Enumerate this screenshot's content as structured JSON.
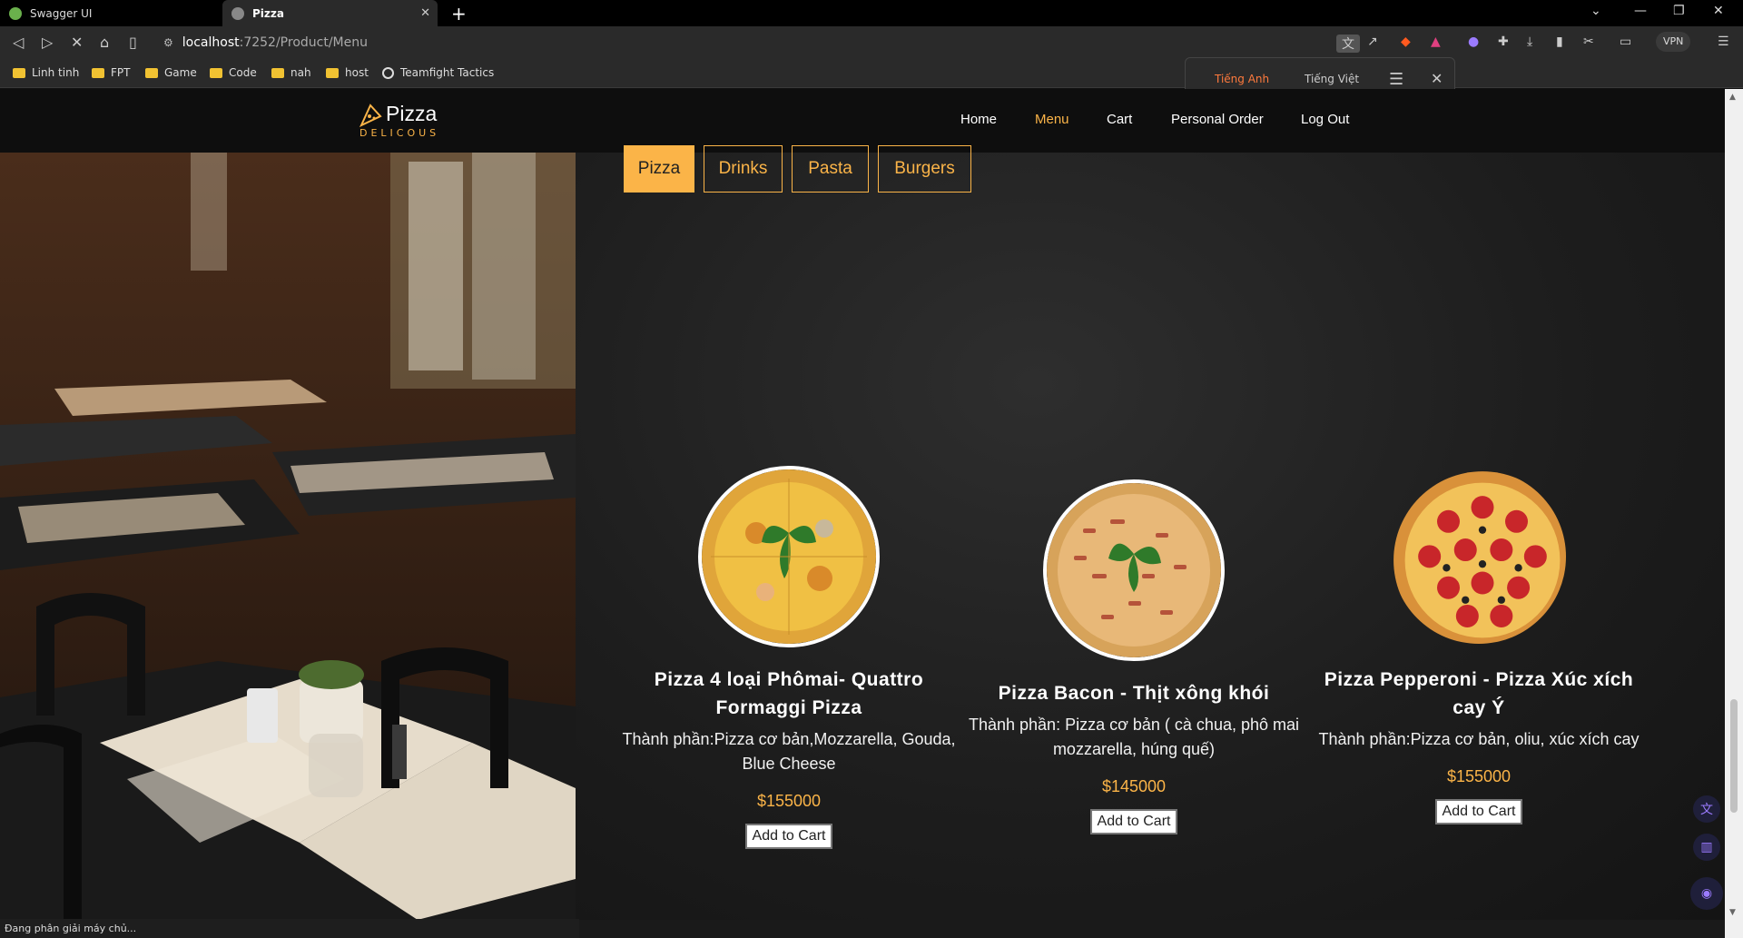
{
  "browser": {
    "tabs": [
      {
        "label": "Swagger UI"
      },
      {
        "label": "Pizza"
      }
    ],
    "url_host": "localhost",
    "url_path": ":7252/Product/Menu",
    "vpn_label": "VPN",
    "bookmarks": [
      "Linh tinh",
      "FPT",
      "Game",
      "Code",
      "nah",
      "host",
      "Teamfight Tactics"
    ],
    "status_text": "Đang phân giải máy chủ..."
  },
  "translate": {
    "active_lang": "Tiếng Anh",
    "other_lang": "Tiếng Việt"
  },
  "site": {
    "logo_text": "Pizza",
    "logo_sub": "DELICOUS",
    "nav": [
      "Home",
      "Menu",
      "Cart",
      "Personal Order",
      "Log Out"
    ],
    "active_nav": "Menu",
    "categories": [
      "Pizza",
      "Drinks",
      "Pasta",
      "Burgers"
    ],
    "active_category": "Pizza"
  },
  "products": [
    {
      "title": "Pizza 4 loại Phômai- Quattro Formaggi Pizza",
      "description": "Thành phần:Pizza cơ bản,Mozzarella, Gouda, Blue Cheese",
      "price": "$155000",
      "button": "Add to Cart"
    },
    {
      "title": "Pizza Bacon - Thịt xông khói",
      "description": "Thành phần: Pizza cơ bản ( cà chua, phô mai mozzarella, húng quế)",
      "price": "$145000",
      "button": "Add to Cart"
    },
    {
      "title": "Pizza Pepperoni - Pizza Xúc xích cay Ý",
      "description": "Thành phần:Pizza cơ bản, oliu, xúc xích cay",
      "price": "$155000",
      "button": "Add to Cart"
    }
  ],
  "colors": {
    "accent": "#fbb448",
    "browser_accent": "#ff7a3d"
  }
}
